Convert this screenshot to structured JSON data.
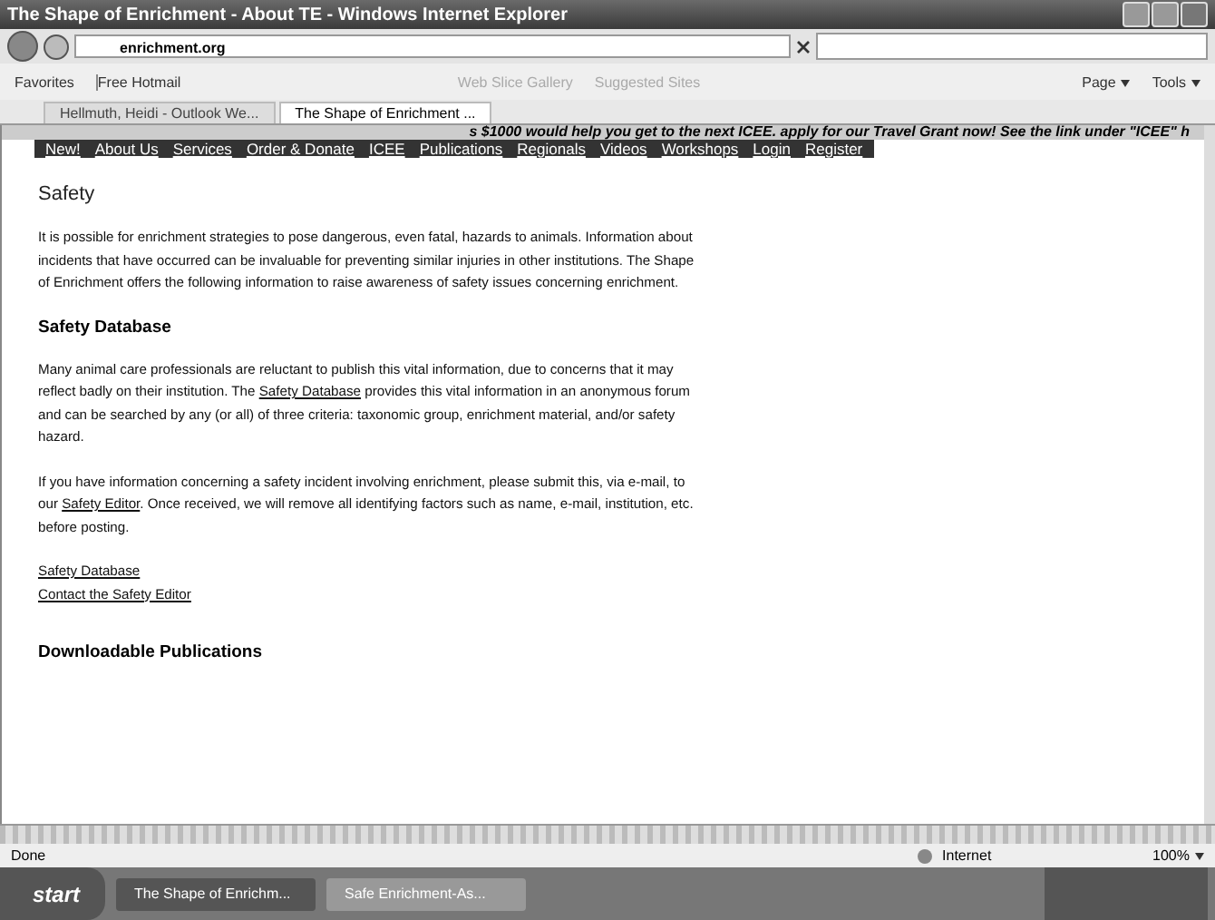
{
  "window": {
    "title": "The Shape of Enrichment - About TE - Windows Internet Explorer"
  },
  "address_bar": {
    "url": "enrichment.org"
  },
  "favorites_bar": {
    "items": [
      {
        "label": "Favorites",
        "kind": "star"
      },
      {
        "label": "Free Hotmail",
        "kind": "page"
      },
      {
        "label": "Web Slice Gallery",
        "kind": "dropdown"
      },
      {
        "label": "Suggested Sites",
        "kind": "dropdown"
      }
    ],
    "commands": [
      "Page",
      "Tools"
    ]
  },
  "tabs": [
    {
      "label": "Hellmuth, Heidi - Outlook We...",
      "selected": false
    },
    {
      "label": "The Shape of Enrichment ...",
      "selected": true
    }
  ],
  "ticker": "s $1000 would help you get to the next ICEE. apply for our Travel Grant now! See the link under \"ICEE\" h",
  "nav": [
    "New!",
    "About Us",
    "Services",
    "Order & Donate",
    "ICEE",
    "Publications",
    "Regionals",
    "Videos",
    "Workshops",
    "Login",
    "Register"
  ],
  "content": [
    {
      "kind": "heading",
      "text": "Safety"
    },
    {
      "kind": "paragraph",
      "before": "It is possible for enrichment strategies to pose dangerous, even fatal, hazards to animals. Information about incidents that have occurred can be invaluable for preventing similar injuries in other institutions. The Shape of Enrichment offers the following information to raise awareness of safety issues concerning enrichment."
    },
    {
      "kind": "subheading",
      "text": "Safety Database"
    },
    {
      "kind": "paragraph",
      "before": "Many animal care professionals are reluctant to publish this vital information, due to concerns that it may reflect badly on their institution. The ",
      "link": "Safety Database",
      "after": " provides this vital information in an anonymous forum and can be searched by any (or all) of three criteria: taxonomic group, enrichment material, and/or safety hazard."
    },
    {
      "kind": "paragraph",
      "before": "If you have information concerning a safety incident involving enrichment, please submit this, via e-mail, to our ",
      "link": "Safety Editor",
      "after": ". Once received, we will remove all identifying factors such as name, e-mail, institution, etc. before posting."
    },
    {
      "kind": "links",
      "items": [
        "Safety Database",
        "Contact the Safety Editor"
      ]
    },
    {
      "kind": "subheading",
      "text": "Downloadable Publications"
    }
  ],
  "status_bar": {
    "status": "Done",
    "zone": "Internet",
    "zoom": "100%"
  },
  "taskbar": {
    "start": "start",
    "tasks": [
      {
        "label": "The Shape of Enrichm...",
        "selected": true
      },
      {
        "label": "Safe Enrichment-As...",
        "selected": false
      }
    ]
  }
}
